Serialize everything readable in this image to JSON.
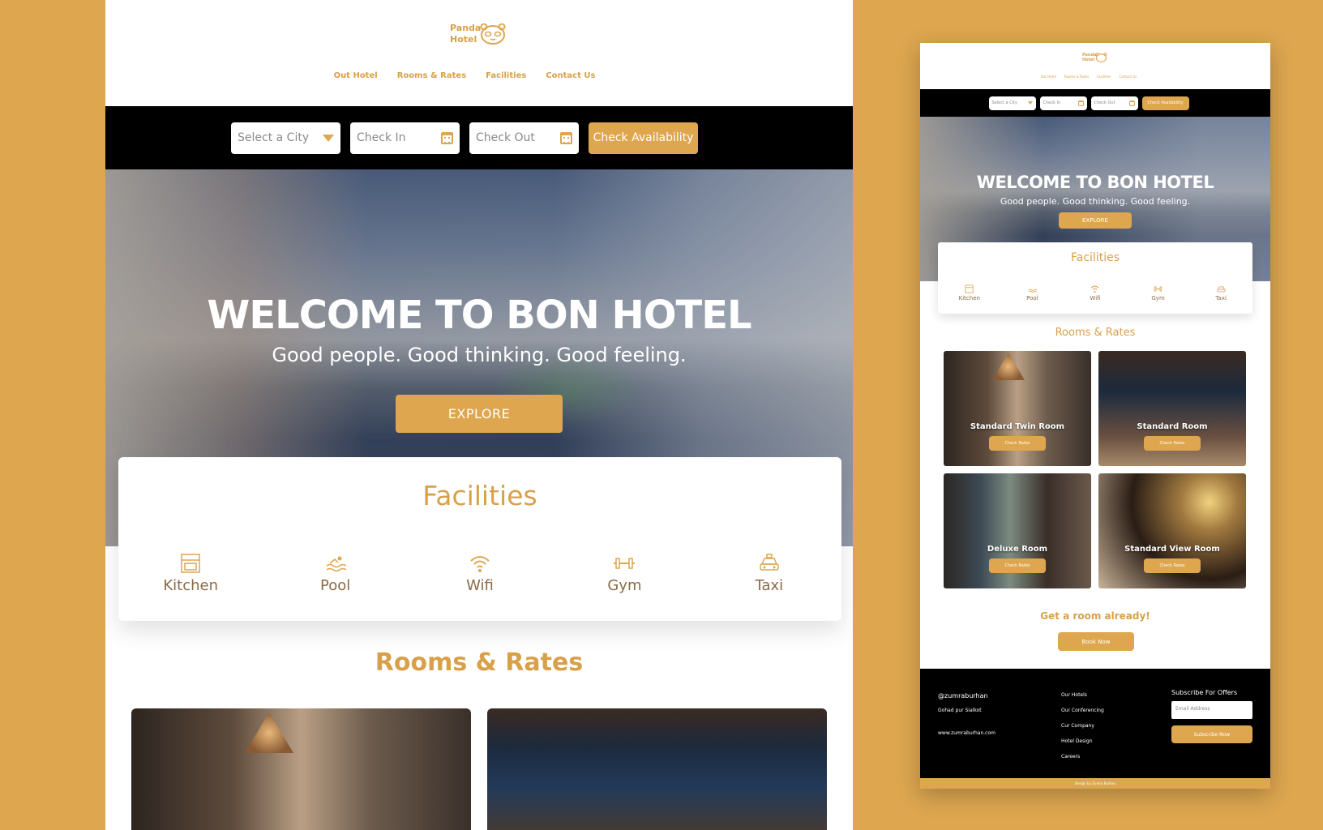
{
  "colors": {
    "accent": "#DDA64F",
    "text_brown": "#8A6A45",
    "dark": "#000000"
  },
  "logo": {
    "line1": "Panda",
    "line2": "Hotel",
    "icon": "panda-icon"
  },
  "nav": [
    "Out  Hotel",
    "Rooms & Rates",
    "Facilities",
    "Contact Us"
  ],
  "search": {
    "city_placeholder": "Select a City",
    "checkin_placeholder": "Check In",
    "checkout_placeholder": "Check Out",
    "button": "Check Availability"
  },
  "hero": {
    "title": "WELCOME TO BON HOTEL",
    "subtitle": "Good people. Good thinking. Good feeling.",
    "button": "EXPLORE"
  },
  "facilities": {
    "title": "Facilities",
    "items": [
      {
        "label": "Kitchen",
        "icon": "kitchen-icon"
      },
      {
        "label": "Pool",
        "icon": "pool-icon"
      },
      {
        "label": "Wifi",
        "icon": "wifi-icon"
      },
      {
        "label": "Gym",
        "icon": "gym-icon"
      },
      {
        "label": "Taxi",
        "icon": "taxi-icon"
      }
    ]
  },
  "rooms": {
    "title": "Rooms & Rates",
    "button": "Check Rates",
    "items": [
      {
        "name": "Standard Twin Room"
      },
      {
        "name": "Standard Room"
      },
      {
        "name": "Deluxe Room"
      },
      {
        "name": "Standard View Room"
      }
    ]
  },
  "cta": {
    "text": "Get a room already!",
    "button": "Book Now"
  },
  "footer": {
    "handle": "@zumraburhan",
    "address": "Gohad pur Sialkot",
    "website": "www.zumraburhan.com",
    "links": [
      "Our Hotels",
      "Our Conferencing",
      "Cur Company",
      "Hotel Design",
      "Careers"
    ],
    "subscribe_title": "Subscribe For Offers",
    "email_placeholder": "Email Address",
    "subscribe_button": "Subscribe Now",
    "credit": "Design by Zumra Burhan"
  }
}
